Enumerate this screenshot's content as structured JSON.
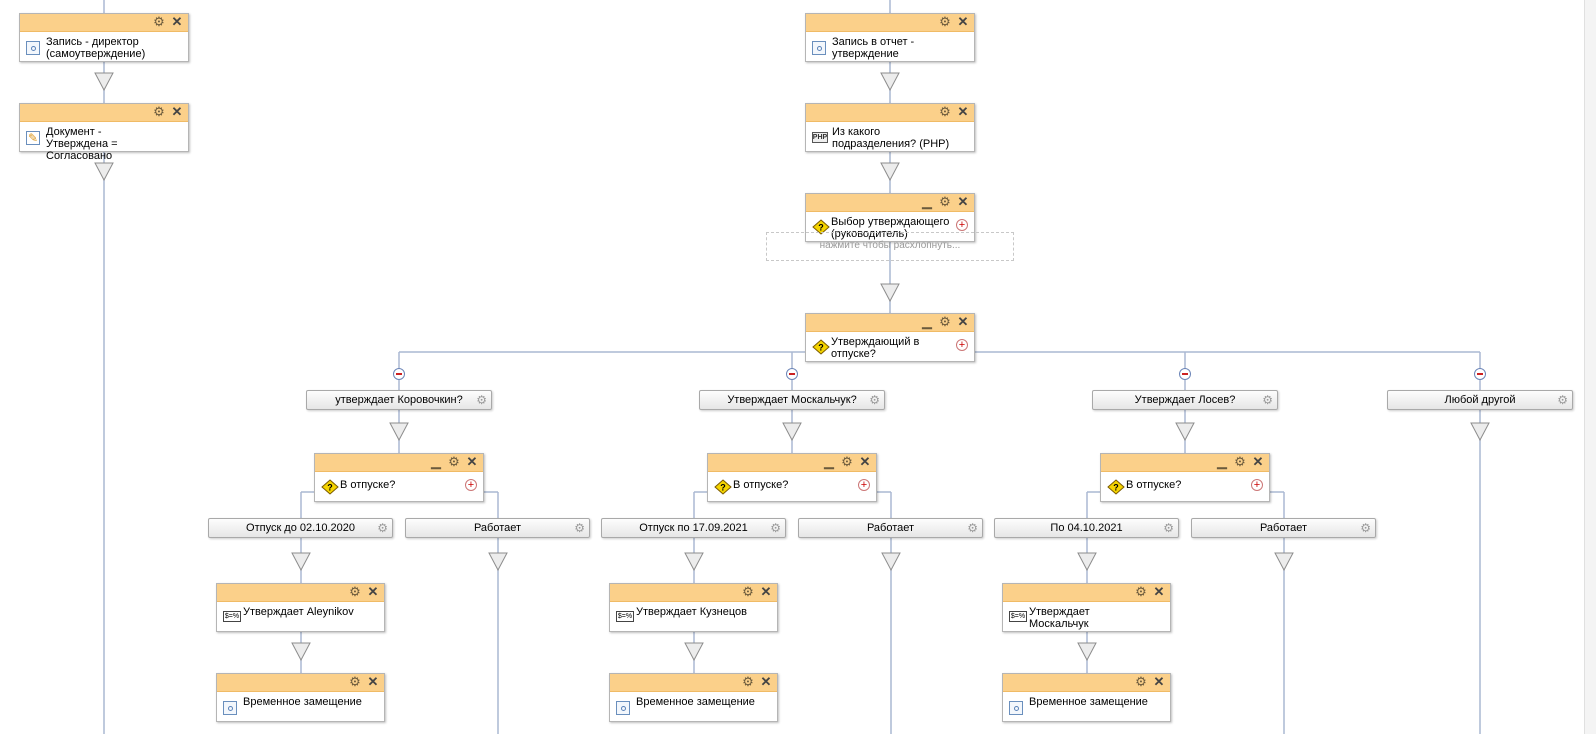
{
  "blocks": {
    "b1": {
      "label": "Запись - директор (самоутверждение)",
      "icon": "record-icon"
    },
    "b2": {
      "label": "Документ - Утверждена = Согласовано",
      "icon": "edit-document-icon"
    },
    "b3": {
      "label": "Запись в отчет - утверждение",
      "icon": "record-icon"
    },
    "b4": {
      "label": "Из какого подразделения? (PHP)",
      "icon": "php-icon",
      "icon_text": "PHP"
    },
    "b5": {
      "label": "Выбор утверждающего (руководитель)",
      "icon": "condition-icon"
    },
    "b6": {
      "label": "Утверждающий в отпуске?",
      "icon": "condition-icon"
    },
    "c1": {
      "label": "В отпуске?",
      "icon": "condition-icon"
    },
    "c2": {
      "label": "В отпуске?",
      "icon": "condition-icon"
    },
    "c3": {
      "label": "В отпуске?",
      "icon": "condition-icon"
    },
    "v1": {
      "label": "Утверждает Aleynikov",
      "icon": "variable-icon",
      "icon_text": "$=%"
    },
    "v2": {
      "label": "Утверждает Кузнецов",
      "icon": "variable-icon",
      "icon_text": "$=%"
    },
    "v3": {
      "label": "Утверждает Москальчук",
      "icon": "variable-icon",
      "icon_text": "$=%"
    },
    "r1": {
      "label": "Временное замещение",
      "icon": "record-icon"
    },
    "r2": {
      "label": "Временное замещение",
      "icon": "record-icon"
    },
    "r3": {
      "label": "Временное замещение",
      "icon": "record-icon"
    }
  },
  "collapsed_hint": "нажмите чтобы расхлопнуть...",
  "branches": {
    "a1": "утверждает Коровочкин?",
    "a2": "Утверждает Москальчук?",
    "a3": "Утверждает Лосев?",
    "a4": "Любой другой",
    "s1": "Отпуск до 02.10.2020",
    "s2": "Работает",
    "s3": "Отпуск по 17.09.2021",
    "s4": "Работает",
    "s5": "По 04.10.2021",
    "s6": "Работает"
  },
  "colors": {
    "header": "#fbd08a",
    "connector": "#aab8d2",
    "arrow_fill": "#ececec"
  }
}
